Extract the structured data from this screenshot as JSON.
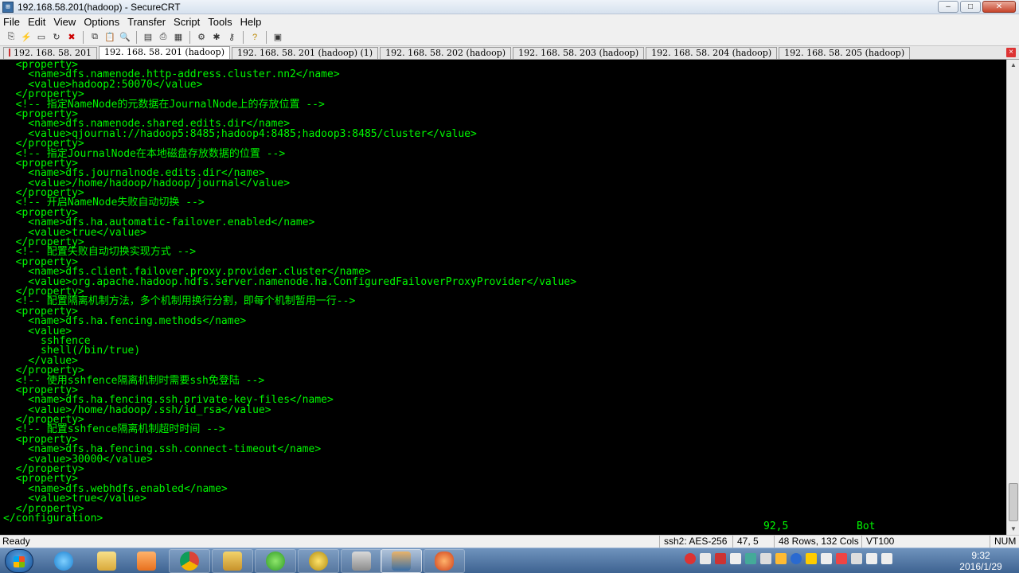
{
  "window": {
    "title": "192.168.58.201(hadoop) - SecureCRT",
    "minimize_glyph": "–",
    "maximize_glyph": "□",
    "close_glyph": "✕"
  },
  "menu": [
    "File",
    "Edit",
    "View",
    "Options",
    "Transfer",
    "Script",
    "Tools",
    "Help"
  ],
  "toolbar_icons": [
    "connect-icon",
    "quick-connect-icon",
    "connect-tab-icon",
    "reconnect-icon",
    "disconnect-icon",
    "copy-icon",
    "paste-icon",
    "find-icon",
    "print-setup-icon",
    "print-icon",
    "print-selection-icon",
    "session-options-icon",
    "global-options-icon",
    "keymap-icon",
    "help-icon",
    "sftp-icon"
  ],
  "tabs": [
    {
      "label": "192. 168. 58. 201",
      "active": false
    },
    {
      "label": "192. 168. 58. 201 (hadoop)",
      "active": true
    },
    {
      "label": "192. 168. 58. 201 (hadoop)  (1)",
      "active": false
    },
    {
      "label": "192. 168. 58. 202 (hadoop)",
      "active": false
    },
    {
      "label": "192. 168. 58. 203 (hadoop)",
      "active": false
    },
    {
      "label": "192. 168. 58. 204 (hadoop)",
      "active": false
    },
    {
      "label": "192. 168. 58. 205 (hadoop)",
      "active": false
    }
  ],
  "terminal": {
    "lines": [
      "  <property>",
      "    <name>dfs.namenode.http-address.cluster.nn2</name>",
      "    <value>hadoop2:50070</value>",
      "  </property>",
      "  <!-- 指定NameNode的元数据在JournalNode上的存放位置 -->",
      "  <property>",
      "    <name>dfs.namenode.shared.edits.dir</name>",
      "    <value>qjournal://hadoop5:8485;hadoop4:8485;hadoop3:8485/cluster</value>",
      "  </property>",
      "  <!-- 指定JournalNode在本地磁盘存放数据的位置 -->",
      "  <property>",
      "    <name>dfs.journalnode.edits.dir</name>",
      "    <value>/home/hadoop/hadoop/journal</value>",
      "  </property>",
      "  <!-- 开启NameNode失败自动切换 -->",
      "  <property>",
      "    <name>dfs.ha.automatic-failover.enabled</name>",
      "    <value>true</value>",
      "  </property>",
      "  <!-- 配置失败自动切换实现方式 -->",
      "  <property>",
      "    <name>dfs.client.failover.proxy.provider.cluster</name>",
      "    <value>org.apache.hadoop.hdfs.server.namenode.ha.ConfiguredFailoverProxyProvider</value>",
      "  </property>",
      "  <!-- 配置隔离机制方法，多个机制用换行分割，即每个机制暂用一行-->",
      "  <property>",
      "    <name>dfs.ha.fencing.methods</name>",
      "    <value>",
      "      sshfence",
      "      shell(/bin/true)",
      "    </value>",
      "  </property>",
      "  <!-- 使用sshfence隔离机制时需要ssh免登陆 -->",
      "  <property>",
      "    <name>dfs.ha.fencing.ssh.private-key-files</name>",
      "    <value>/home/hadoop/.ssh/id_rsa</value>",
      "  </property>",
      "  <!-- 配置sshfence隔离机制超时时间 -->",
      "  <property>",
      "    <name>dfs.ha.fencing.ssh.connect-timeout</name>",
      "    <value>30000</value>",
      "  </property>",
      "  <property>",
      "    <name>dfs.webhdfs.enabled</name>",
      "    <value>true</value>",
      "  </property>",
      "</configuration>"
    ],
    "cursor_pos": "92,5",
    "scroll_label": "Bot"
  },
  "scrollbar": {
    "up": "▲",
    "down": "▼"
  },
  "statusbar": {
    "ready": "Ready",
    "cipher": "ssh2: AES-256",
    "cursor": "47,  5",
    "size": "48 Rows, 132 Cols",
    "terminal": "VT100",
    "numlock": "NUM"
  },
  "tabclose": "×",
  "taskbar": {
    "time": "9:32",
    "date": "2016/1/29"
  },
  "colors": {
    "terminal_bg": "#000000",
    "terminal_fg": "#00f700"
  }
}
